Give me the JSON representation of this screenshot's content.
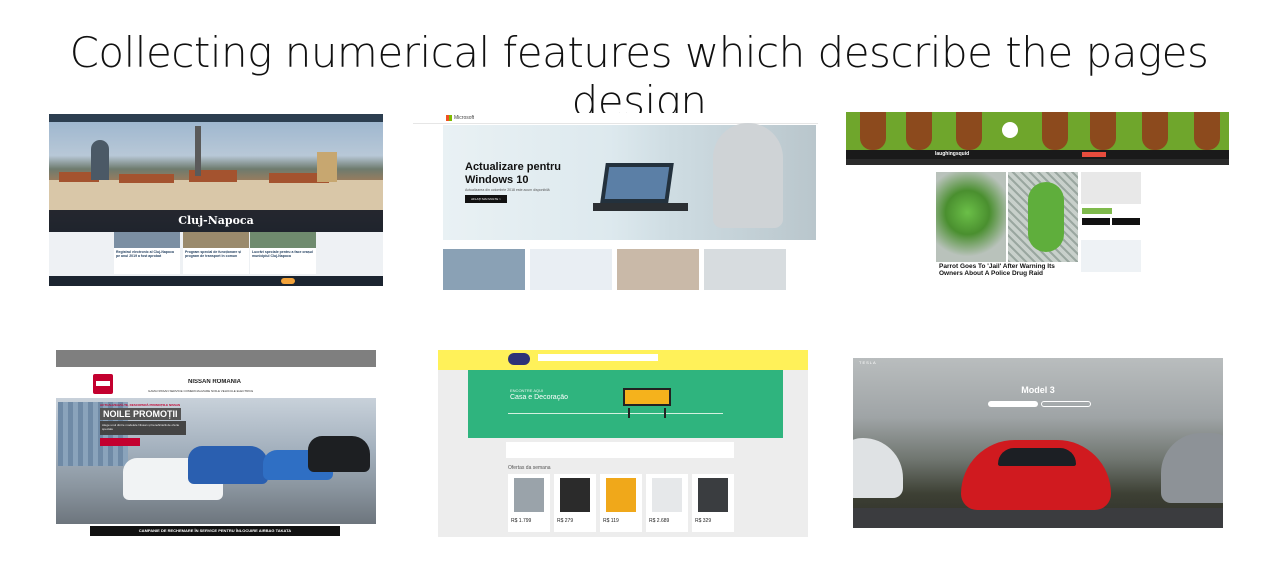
{
  "slide": {
    "title": "Collecting numerical features which describe the pages design"
  },
  "screenshots": {
    "cluj": {
      "city_title": "Cluj-Napoca",
      "news": [
        "Registrul electronic al Cluj-Napoca pe anul 2019 a fost aprobat",
        "Program special de funcționare și program de transport în comun",
        "Lucrări speciale pentru a face orașul municipiul Cluj-Napoca"
      ]
    },
    "microsoft": {
      "brand": "Microsoft",
      "hero_line1": "Actualizare pentru",
      "hero_line2": "Windows 10",
      "hero_desc": "Actualizarea din octombrie 2018 este acum disponibilă",
      "cta": "AFLAȚI MAI MULTE  >"
    },
    "laughing_squid": {
      "brand": "laughingsquid",
      "article_title": "Parrot Goes To 'Jail' After Warning Its Owners About A Police Drug Raid"
    },
    "nissan": {
      "brand": "NISSAN ROMÂNIA",
      "menu": "GAMA NISSAN   SERVICE   COMERCIALIZARE   NOILE VEHICULE ELECTRICE",
      "promo_kicker": "ACTUALIZEAZĂ-TE, DESCOPERĂ PROMOȚIILE NISSAN",
      "promo_title": "NOILE PROMOȚII",
      "promo_text": "Alege unul dintre modelele Nissan și beneficiază de oferte speciale",
      "footer": "CAMPANIE DE RECHEMARE ÎN SERVICE PENTRU ÎNLOCUIRE AIRBAG TAKATA"
    },
    "mercado": {
      "hero_tag": "ENCONTRE AQUI",
      "hero_category": "Casa e Decoração",
      "section_heading": "Ofertas da semana",
      "prices": [
        "R$ 1.799",
        "R$ 279",
        "R$ 119",
        "R$ 2.689",
        "R$ 329"
      ]
    },
    "tesla": {
      "brand": "TESLA",
      "model": "Model 3"
    }
  }
}
